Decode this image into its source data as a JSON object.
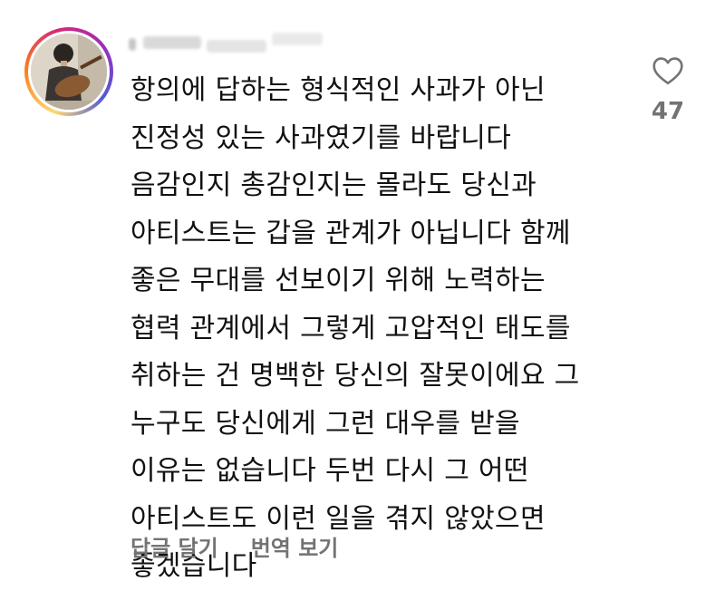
{
  "comment": {
    "username": "",
    "text": "항의에 답하는 형식적인 사과가 아닌\n진정성 있는 사과였기를 바랍니다\n음감인지 총감인지는 몰라도 당신과\n아티스트는 갑을 관계가 아닙니다 함께\n좋은 무대를 선보이기 위해 노력하는\n협력 관계에서 그렇게 고압적인 태도를\n취하는 건 명백한 당신의 잘못이에요 그\n누구도 당신에게 그런 대우를 받을\n이유는 없습니다 두번 다시 그 어떤\n아티스트도 이런 일을 겪지 않았으면\n좋겠습니다",
    "like_icon": "heart-outline-icon",
    "like_count": "47"
  },
  "actions": {
    "reply_label": "답글 달기",
    "translate_label": "번역 보기"
  },
  "colors": {
    "text": "#111111",
    "muted": "#737373",
    "story_ring": [
      "#feda75",
      "#fa7e1e",
      "#d62976",
      "#962fbf",
      "#4f5bd5"
    ]
  }
}
